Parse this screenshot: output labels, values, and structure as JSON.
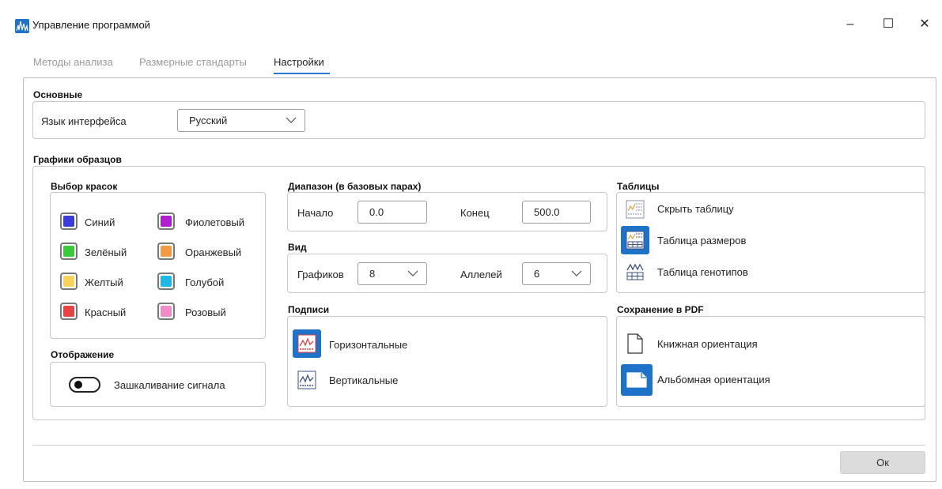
{
  "window": {
    "title": "Управление программой",
    "minimize": "–",
    "maximize": "☐",
    "close": "✕"
  },
  "tabs": [
    {
      "label": "Методы анализа",
      "active": false
    },
    {
      "label": "Размерные стандарты",
      "active": false
    },
    {
      "label": "Настройки",
      "active": true
    }
  ],
  "basic": {
    "title": "Основные",
    "language_label": "Язык интерфейса",
    "language_value": "Русский"
  },
  "plots": {
    "title": "Графики образцов",
    "colors": {
      "title": "Выбор красок",
      "items": [
        {
          "label": "Синий",
          "color": "#3b3bdc"
        },
        {
          "label": "Фиолетовый",
          "color": "#b01ed0"
        },
        {
          "label": "Зелёный",
          "color": "#3ac93a"
        },
        {
          "label": "Оранжевый",
          "color": "#f49a44"
        },
        {
          "label": "Желтый",
          "color": "#f7d45a"
        },
        {
          "label": "Голубой",
          "color": "#1fb6e8"
        },
        {
          "label": "Красный",
          "color": "#e84343"
        },
        {
          "label": "Розовый",
          "color": "#f28cc8"
        }
      ]
    },
    "display": {
      "title": "Отображение",
      "signal_label": "Зашкаливание сигнала",
      "signal_on": false
    },
    "range": {
      "title": "Диапазон (в базовых парах)",
      "start_label": "Начало",
      "start_value": "0.0",
      "end_label": "Конец",
      "end_value": "500.0"
    },
    "view": {
      "title": "Вид",
      "plots_label": "Графиков",
      "plots_value": "8",
      "alleles_label": "Аллелей",
      "alleles_value": "6"
    },
    "labels": {
      "title": "Подписи",
      "horizontal": "Горизонтальные",
      "vertical": "Вертикальные",
      "selected": "horizontal"
    },
    "tables": {
      "title": "Таблицы",
      "hide": "Скрыть таблицу",
      "sizes": "Таблица размеров",
      "genotypes": "Таблица генотипов",
      "selected": "sizes"
    },
    "pdf": {
      "title": "Сохранение в PDF",
      "portrait": "Книжная ориентация",
      "landscape": "Альбомная ориентация",
      "selected": "landscape"
    }
  },
  "footer": {
    "ok_label": "Ок"
  },
  "accent": "#1e73c9"
}
